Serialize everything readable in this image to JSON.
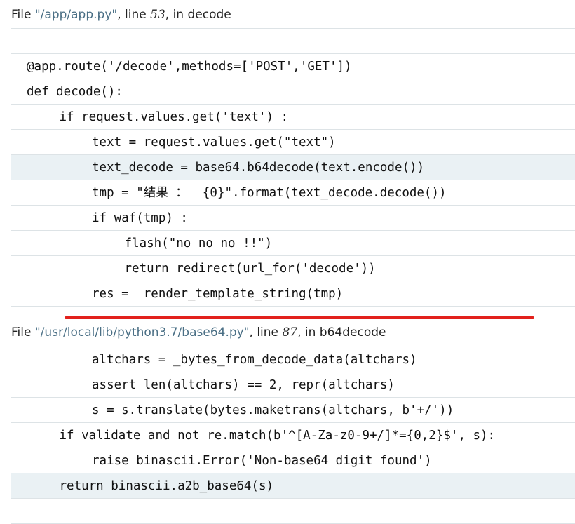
{
  "frames": [
    {
      "header": {
        "prefix": "File ",
        "filename": "\"/app/app.py\"",
        "line_label": ", line ",
        "line_number": "53",
        "in_label": ", in ",
        "function": "decode"
      },
      "lines": [
        {
          "indent": 0,
          "text": "",
          "current": false
        },
        {
          "indent": 0,
          "text": "@app.route('/decode',methods=['POST','GET'])",
          "current": false
        },
        {
          "indent": 0,
          "text": "def decode():",
          "current": false
        },
        {
          "indent": 1,
          "text": "if request.values.get('text') :",
          "current": false
        },
        {
          "indent": 2,
          "text": "text = request.values.get(\"text\")",
          "current": false
        },
        {
          "indent": 2,
          "text": "text_decode = base64.b64decode(text.encode())",
          "current": true
        },
        {
          "indent": 2,
          "text": "tmp = \"结果 ：  {0}\".format(text_decode.decode())",
          "current": false
        },
        {
          "indent": 2,
          "text": "if waf(tmp) :",
          "current": false
        },
        {
          "indent": 3,
          "text": "flash(\"no no no !!\")",
          "current": false
        },
        {
          "indent": 3,
          "text": "return redirect(url_for('decode'))",
          "current": false
        },
        {
          "indent": 2,
          "text": "res =  render_template_string(tmp)",
          "current": false
        }
      ]
    },
    {
      "header": {
        "prefix": "File ",
        "filename": "\"/usr/local/lib/python3.7/base64.py\"",
        "line_label": ", line ",
        "line_number": "87",
        "in_label": ", in ",
        "function": "b64decode"
      },
      "lines": [
        {
          "indent": 2,
          "text": "altchars = _bytes_from_decode_data(altchars)",
          "current": false
        },
        {
          "indent": 2,
          "text": "assert len(altchars) == 2, repr(altchars)",
          "current": false
        },
        {
          "indent": 2,
          "text": "s = s.translate(bytes.maketrans(altchars, b'+/'))",
          "current": false
        },
        {
          "indent": 1,
          "text": "if validate and not re.match(b'^[A-Za-z0-9+/]*={0,2}$', s):",
          "current": false
        },
        {
          "indent": 2,
          "text": "raise binascii.Error('Non-base64 digit found')",
          "current": false
        },
        {
          "indent": 1,
          "text": "return binascii.a2b_base64(s)",
          "current": true
        },
        {
          "indent": 0,
          "text": "",
          "current": false
        }
      ]
    }
  ],
  "colors": {
    "filename": "#4a6f85",
    "current_line_bg": "#eaf1f4",
    "row_border": "#dde3e6",
    "annotation_underline": "#e2211c"
  }
}
